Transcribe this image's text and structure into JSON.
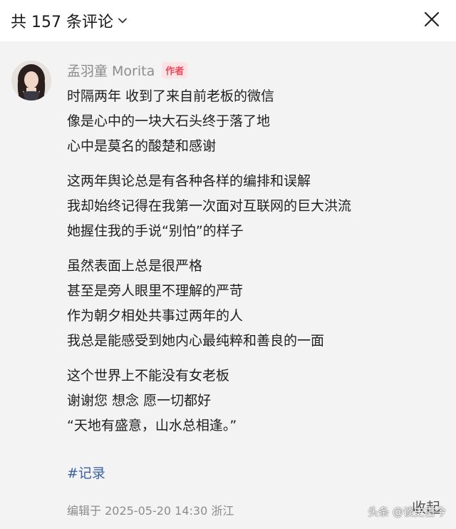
{
  "header": {
    "title": "共 157 条评论",
    "dropdown_icon": "chevron-down-icon",
    "close_icon": "close-icon"
  },
  "comment": {
    "author": {
      "name": "孟羽童 Morita",
      "badge": "作者"
    },
    "paragraphs": [
      [
        "时隔两年 收到了来自前老板的微信",
        "像是心中的一块大石头终于落了地",
        "心中是莫名的酸楚和感谢"
      ],
      [
        "这两年舆论总是有各种各样的编排和误解",
        "我却始终记得在我第一次面对互联网的巨大洪流",
        "她握住我的手说“别怕”的样子"
      ],
      [
        "虽然表面上总是很严格",
        "甚至是旁人眼里不理解的严苛",
        "作为朝夕相处共事过两年的人",
        "我总是能感受到她内心最纯粹和善良的一面"
      ],
      [
        "这个世界上不能没有女老板",
        "谢谢您 想念 愿一切都好",
        "“天地有盛意，山水总相逢。”"
      ]
    ],
    "hashtag": "#记录",
    "meta": "编辑于  2025-05-20 14:30 浙江",
    "collapse_label": "收起"
  },
  "watermark": "头条 @谈史古今",
  "colors": {
    "background": "#f3f3f3",
    "header_bg": "#ffffff",
    "author_name": "#8c8c8c",
    "badge_text": "#f0485a",
    "badge_bg": "#fde3e6",
    "hashtag": "#3a5fa0"
  }
}
